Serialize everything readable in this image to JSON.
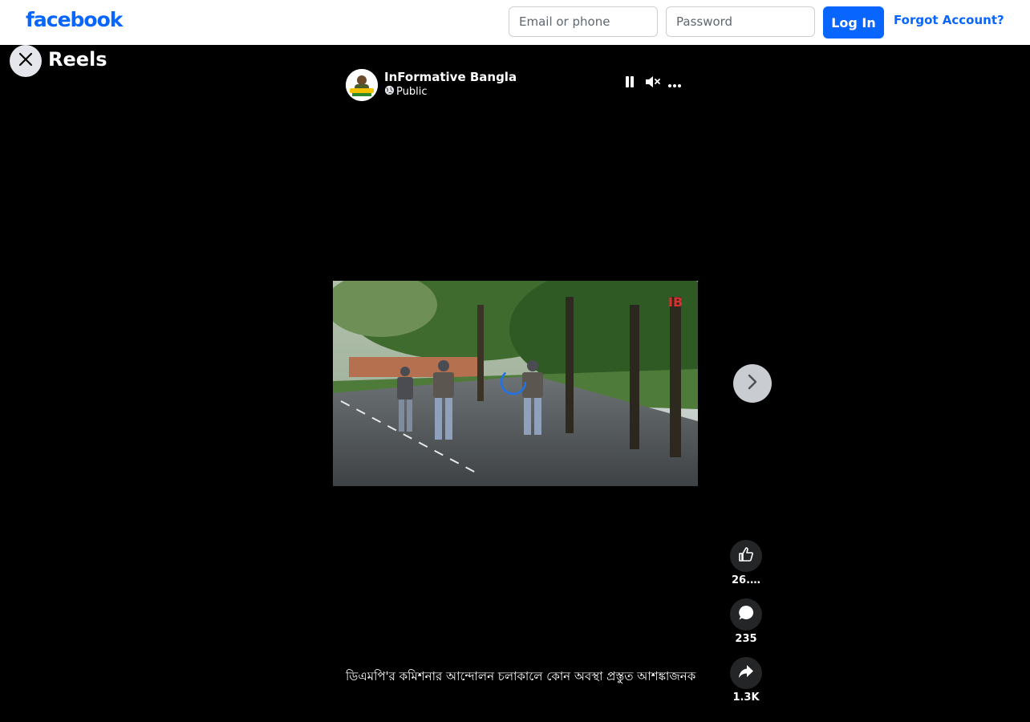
{
  "header": {
    "logo": "facebook",
    "email_placeholder": "Email or phone",
    "password_placeholder": "Password",
    "login_label": "Log In",
    "forgot_label": "Forgot Account?"
  },
  "reels": {
    "title": "Reels"
  },
  "post": {
    "author": "InFormative Bangla",
    "audience": "Public",
    "caption": "ডিএমপি'র কমিশনার আন্দোলন চলাকালে কোন অবস্থা প্রস্তুত আশঙ্কাজনক"
  },
  "actions": {
    "likes": "26.…",
    "comments": "235",
    "shares": "1.3K"
  },
  "colors": {
    "brand": "#0866ff",
    "background": "#000000",
    "action_bg": "#242526"
  }
}
